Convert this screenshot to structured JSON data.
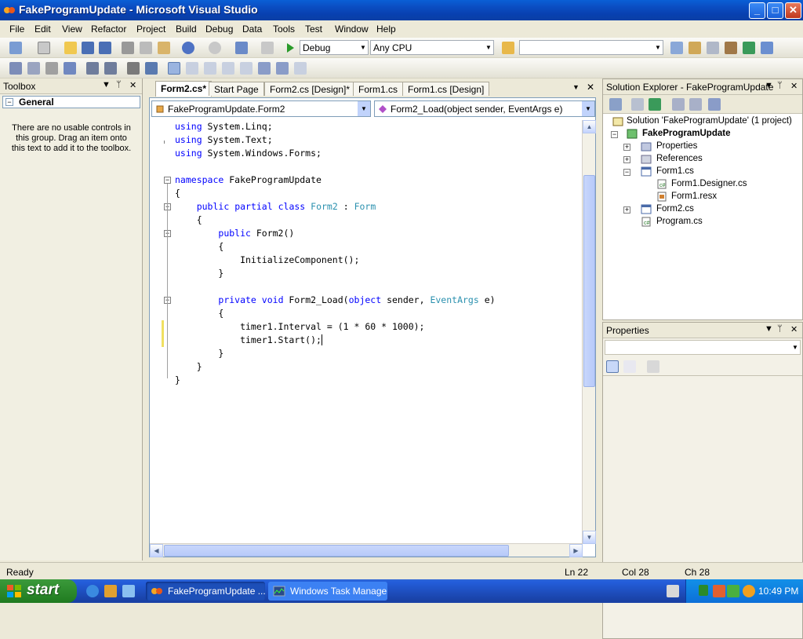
{
  "window": {
    "title": "FakeProgramUpdate - Microsoft Visual Studio",
    "minimize": "_",
    "maximize": "□",
    "close": "✕"
  },
  "menu": [
    "File",
    "Edit",
    "View",
    "Refactor",
    "Project",
    "Build",
    "Debug",
    "Data",
    "Tools",
    "Test",
    "Window",
    "Help"
  ],
  "toolbar": {
    "configuration": "Debug",
    "platform": "Any CPU",
    "find_value": ""
  },
  "toolbox": {
    "title": "Toolbox",
    "group": "General",
    "message": "There are no usable controls in this group. Drag an item onto this text to add it to the toolbox."
  },
  "tabs": [
    {
      "label": "Form2.cs*",
      "active": true
    },
    {
      "label": "Start Page",
      "active": false
    },
    {
      "label": "Form2.cs [Design]*",
      "active": false
    },
    {
      "label": "Form1.cs",
      "active": false
    },
    {
      "label": "Form1.cs [Design]",
      "active": false
    }
  ],
  "editor": {
    "type_combo": "FakeProgramUpdate.Form2",
    "member_combo": "Form2_Load(object sender, EventArgs e)"
  },
  "solution_explorer": {
    "title": "Solution Explorer - FakeProgramUpdate",
    "solution": "Solution 'FakeProgramUpdate' (1 project)",
    "project": "FakeProgramUpdate",
    "items": [
      "Properties",
      "References",
      "Form1.cs",
      "Form1.Designer.cs",
      "Form1.resx",
      "Form2.cs",
      "Program.cs"
    ]
  },
  "properties": {
    "title": "Properties"
  },
  "status": {
    "message": "Ready",
    "line": "Ln 22",
    "col": "Col 28",
    "ch": "Ch 28"
  },
  "taskbar": {
    "start": "start",
    "buttons": [
      "FakeProgramUpdate ...",
      "Windows Task Manager"
    ],
    "clock": "10:49 PM"
  },
  "colors": {
    "keyword": "#0000ff",
    "type": "#2b91af"
  }
}
